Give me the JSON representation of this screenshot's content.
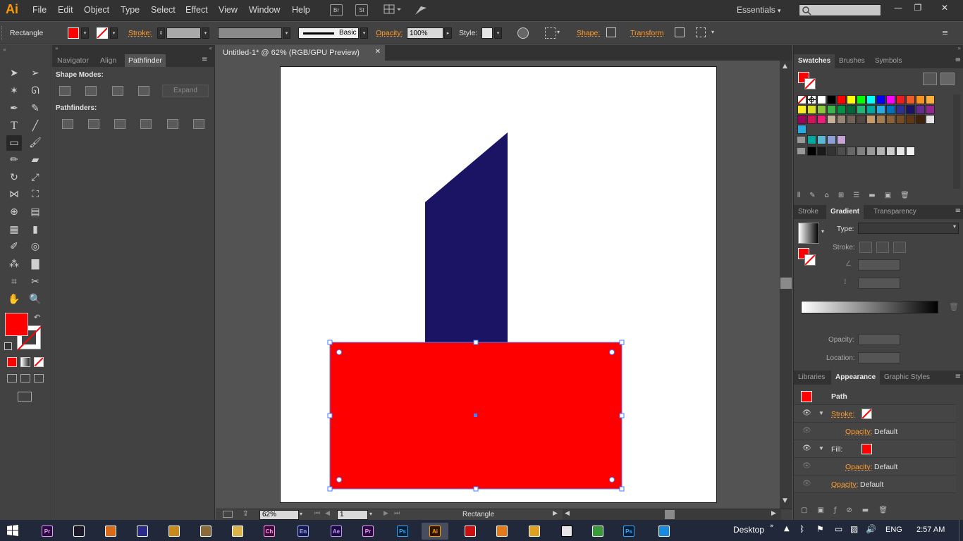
{
  "app": {
    "logo": "Ai"
  },
  "menu": [
    "File",
    "Edit",
    "Object",
    "Type",
    "Select",
    "Effect",
    "View",
    "Window",
    "Help"
  ],
  "menubar": {
    "bridge_label": "Br",
    "stock_label": "St",
    "workspace": "Essentials"
  },
  "control": {
    "tool_name": "Rectangle",
    "stroke_label": "Stroke:",
    "brush_label": "Basic",
    "opacity_label": "Opacity:",
    "opacity_value": "100%",
    "style_label": "Style:",
    "shape_label": "Shape:",
    "transform_label": "Transform"
  },
  "left_panel": {
    "tabs": [
      "Navigator",
      "Align",
      "Pathfinder"
    ],
    "shape_modes_label": "Shape Modes:",
    "expand_label": "Expand",
    "pathfinders_label": "Pathfinders:"
  },
  "document": {
    "tab_title": "Untitled-1* @ 62% (RGB/GPU Preview)",
    "zoom": "62%",
    "artboard_num": "1",
    "status_tool": "Rectangle"
  },
  "right_panel": {
    "swatch_tabs": [
      "Swatches",
      "Brushes",
      "Symbols"
    ],
    "gradient_tabs": [
      "Stroke",
      "Gradient",
      "Transparency"
    ],
    "type_label": "Type:",
    "stroke_label": "Stroke:",
    "opacity_label": "Opacity:",
    "location_label": "Location:",
    "appearance_tabs": [
      "Libraries",
      "Appearance",
      "Graphic Styles"
    ],
    "appearance": {
      "path_label": "Path",
      "stroke_label": "Stroke:",
      "opacity_label": "Opacity:",
      "default_label": "Default",
      "fill_label": "Fill:"
    }
  },
  "taskbar": {
    "desktop_label": "Desktop",
    "lang": "ENG",
    "time": "2:57 AM",
    "apps": [
      {
        "label": "Pr",
        "color": "#2a0a3d",
        "fg": "#e99cff"
      },
      {
        "label": "",
        "color": "#1a1a2a",
        "fg": "#fff"
      },
      {
        "label": "",
        "color": "#d86a1a",
        "fg": "#fff"
      },
      {
        "label": "",
        "color": "#2a2a8a",
        "fg": "#fff"
      },
      {
        "label": "",
        "color": "#c88a1a",
        "fg": "#fff"
      },
      {
        "label": "",
        "color": "#8a6a3a",
        "fg": "#fff"
      },
      {
        "label": "",
        "color": "#d9b44a",
        "fg": "#fff"
      },
      {
        "label": "Ch",
        "color": "#3d0a3a",
        "fg": "#ff9ae6"
      },
      {
        "label": "En",
        "color": "#1a1a4a",
        "fg": "#9ab0ff"
      },
      {
        "label": "Ae",
        "color": "#1a0a3d",
        "fg": "#c29aff"
      },
      {
        "label": "Pr",
        "color": "#2a0a3d",
        "fg": "#e99cff"
      },
      {
        "label": "Ps",
        "color": "#061e33",
        "fg": "#31a8ff"
      },
      {
        "label": "Ai",
        "color": "#2d1600",
        "fg": "#ff9a00"
      },
      {
        "label": "",
        "color": "#cc1010",
        "fg": "#fff"
      },
      {
        "label": "",
        "color": "#e57a1a",
        "fg": "#fff"
      },
      {
        "label": "",
        "color": "#e0a020",
        "fg": "#fff"
      },
      {
        "label": "",
        "color": "#e6e6e6",
        "fg": "#000"
      },
      {
        "label": "",
        "color": "#3a9a3a",
        "fg": "#fff"
      },
      {
        "label": "Ps",
        "color": "#061e33",
        "fg": "#31a8ff"
      },
      {
        "label": "",
        "color": "#1a8ae0",
        "fg": "#fff"
      }
    ]
  },
  "colors": {
    "fill": "#ff0000",
    "navy_shape": "#1b1464",
    "accent": "#ff9d2f"
  }
}
